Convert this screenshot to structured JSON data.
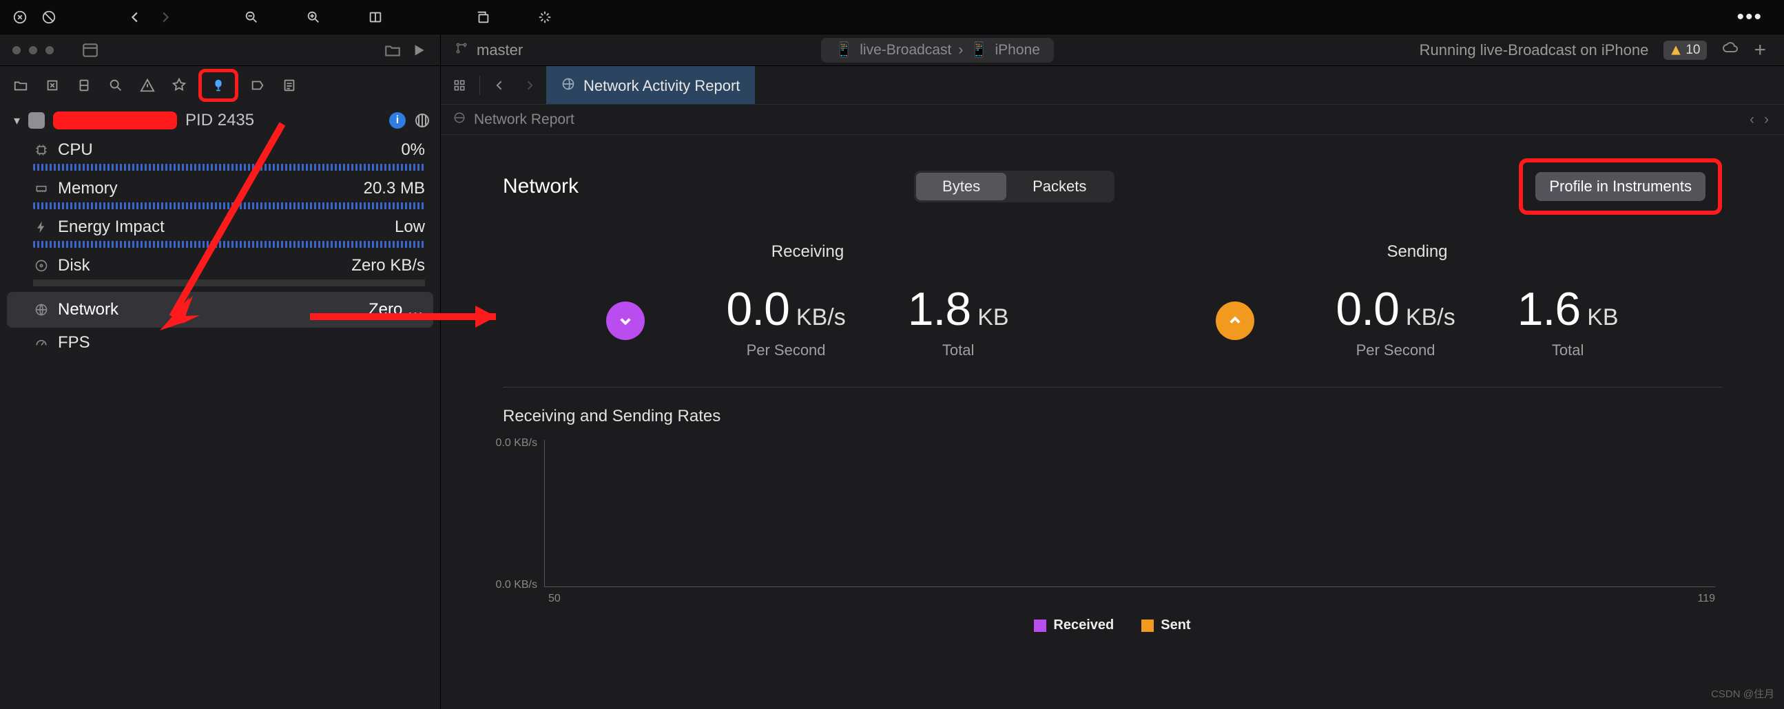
{
  "toolbar": {
    "more": "•••"
  },
  "scheme": {
    "branch": "master",
    "pill_target": "live-Broadcast",
    "pill_sep": "›",
    "pill_device": "iPhone",
    "status": "Running live-Broadcast on iPhone",
    "issue_count": "10"
  },
  "navigator": {
    "process_pid": "PID 2435",
    "metrics": [
      {
        "icon": "cpu",
        "label": "CPU",
        "value": "0%",
        "bar": true
      },
      {
        "icon": "memory",
        "label": "Memory",
        "value": "20.3 MB",
        "bar": true
      },
      {
        "icon": "bolt",
        "label": "Energy Impact",
        "value": "Low",
        "bar": true
      },
      {
        "icon": "disk",
        "label": "Disk",
        "value": "Zero KB/s",
        "bar": true
      },
      {
        "icon": "globe",
        "label": "Network",
        "value": "Zero …",
        "bar": false,
        "selected": true
      },
      {
        "icon": "gauge",
        "label": "FPS",
        "value": "",
        "bar": false
      }
    ]
  },
  "editor": {
    "tab_label": "Network Activity Report",
    "jump_label": "Network Report"
  },
  "report": {
    "title": "Network",
    "seg": {
      "bytes": "Bytes",
      "packets": "Packets"
    },
    "profile_btn": "Profile in Instruments",
    "receiving": {
      "title": "Receiving",
      "rate_value": "0.0",
      "rate_unit": "KB/s",
      "rate_sub": "Per Second",
      "total_value": "1.8",
      "total_unit": "KB",
      "total_sub": "Total"
    },
    "sending": {
      "title": "Sending",
      "rate_value": "0.0",
      "rate_unit": "KB/s",
      "rate_sub": "Per Second",
      "total_value": "1.6",
      "total_unit": "KB",
      "total_sub": "Total"
    },
    "chart_title": "Receiving and Sending Rates",
    "legend": {
      "received": "Received",
      "sent": "Sent"
    }
  },
  "chart_data": {
    "type": "line",
    "title": "Receiving and Sending Rates",
    "xlabel": "",
    "ylabel": "",
    "x_range": [
      50,
      119
    ],
    "y_ticks": [
      "0.0 KB/s",
      "0.0 KB/s"
    ],
    "x_ticks": [
      "50",
      "119"
    ],
    "series": [
      {
        "name": "Received",
        "color": "#b94df0",
        "values": []
      },
      {
        "name": "Sent",
        "color": "#f29a1f",
        "values": []
      }
    ]
  },
  "watermark": "CSDN @住月"
}
